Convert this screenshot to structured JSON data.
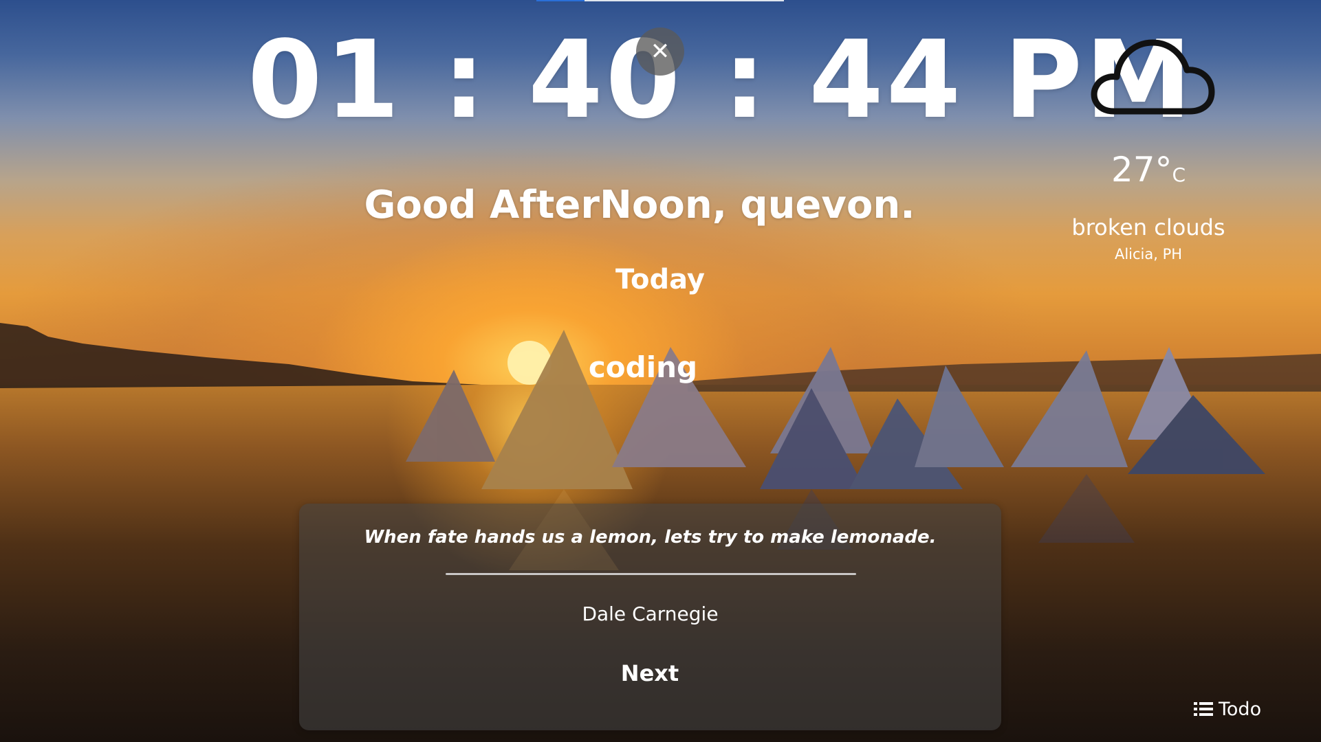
{
  "clock": {
    "time": "01 : 40 : 44 PM"
  },
  "close_button": {
    "icon": "close-icon",
    "glyph": "✕"
  },
  "weather": {
    "icon": "cloud-icon",
    "temperature": "27°",
    "unit": "C",
    "description": "broken clouds",
    "location": "Alicia, PH"
  },
  "greeting": {
    "text": "Good AfterNoon, quevon."
  },
  "focus": {
    "label": "Today",
    "value": "coding"
  },
  "quote": {
    "text": "When fate hands us a lemon, lets try to make lemonade.",
    "author": "Dale Carnegie",
    "next_label": "Next"
  },
  "todo": {
    "label": "Todo",
    "icon": "list-icon"
  },
  "colors": {
    "accent": "#2a6fd8",
    "text": "#ffffff"
  }
}
